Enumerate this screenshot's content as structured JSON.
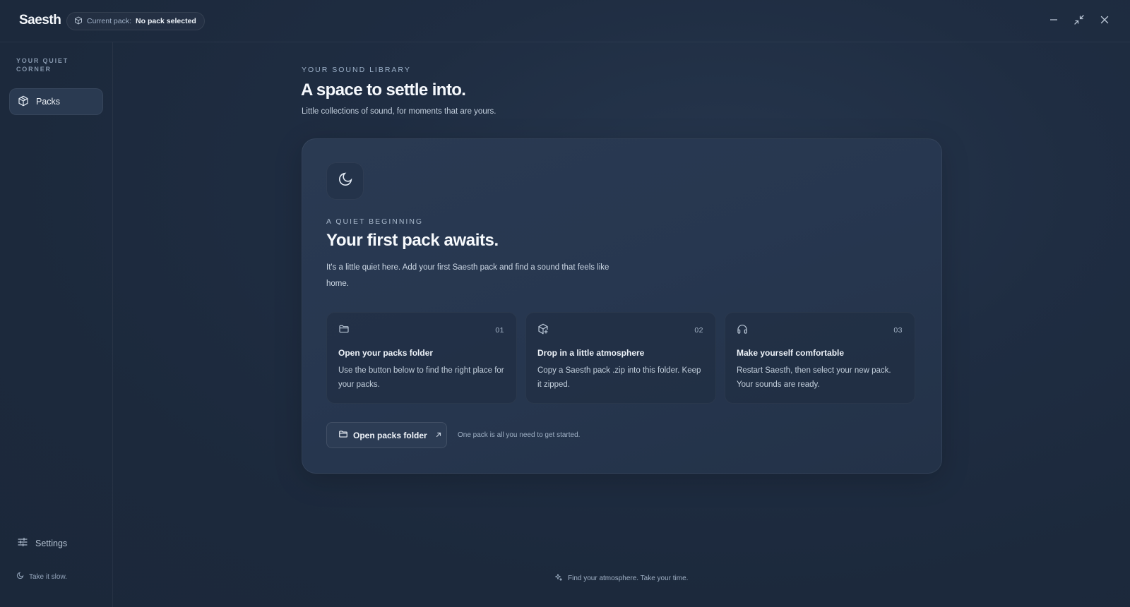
{
  "app": {
    "brand": "Saesth",
    "current_pack_label": "Current pack:",
    "current_pack_value": "No pack selected"
  },
  "window_controls": {
    "minimize_icon": "minimize-icon",
    "restore_icon": "restore-icon",
    "close_icon": "close-icon"
  },
  "sidebar": {
    "heading": "YOUR QUIET CORNER",
    "items": [
      {
        "label": "Packs",
        "icon": "package-icon",
        "active": true
      }
    ],
    "settings_label": "Settings",
    "footer_text": "Take it slow."
  },
  "main": {
    "eyebrow": "YOUR SOUND LIBRARY",
    "title": "A space to settle into.",
    "subtitle": "Little collections of sound, for moments that are yours."
  },
  "card": {
    "eyebrow": "A QUIET BEGINNING",
    "title": "Your first pack awaits.",
    "body": "It's a little quiet here. Add your first Saesth pack and find a sound that feels like home.",
    "steps": [
      {
        "number": "01",
        "icon": "folder-icon",
        "title": "Open your packs folder",
        "text": "Use the button below to find the right place for your packs."
      },
      {
        "number": "02",
        "icon": "package-plus-icon",
        "title": "Drop in a little atmosphere",
        "text": "Copy a Saesth pack .zip into this folder. Keep it zipped."
      },
      {
        "number": "03",
        "icon": "headphones-icon",
        "title": "Make yourself comfortable",
        "text": "Restart Saesth, then select your new pack. Your sounds are ready."
      }
    ],
    "button_label": "Open packs folder",
    "button_hint": "One pack is all you need to get started."
  },
  "footer": {
    "text": "Find your atmosphere. Take your time."
  },
  "colors": {
    "background": "#1d2a3e",
    "card": "#273750",
    "nav_active": "#2a3a51"
  }
}
